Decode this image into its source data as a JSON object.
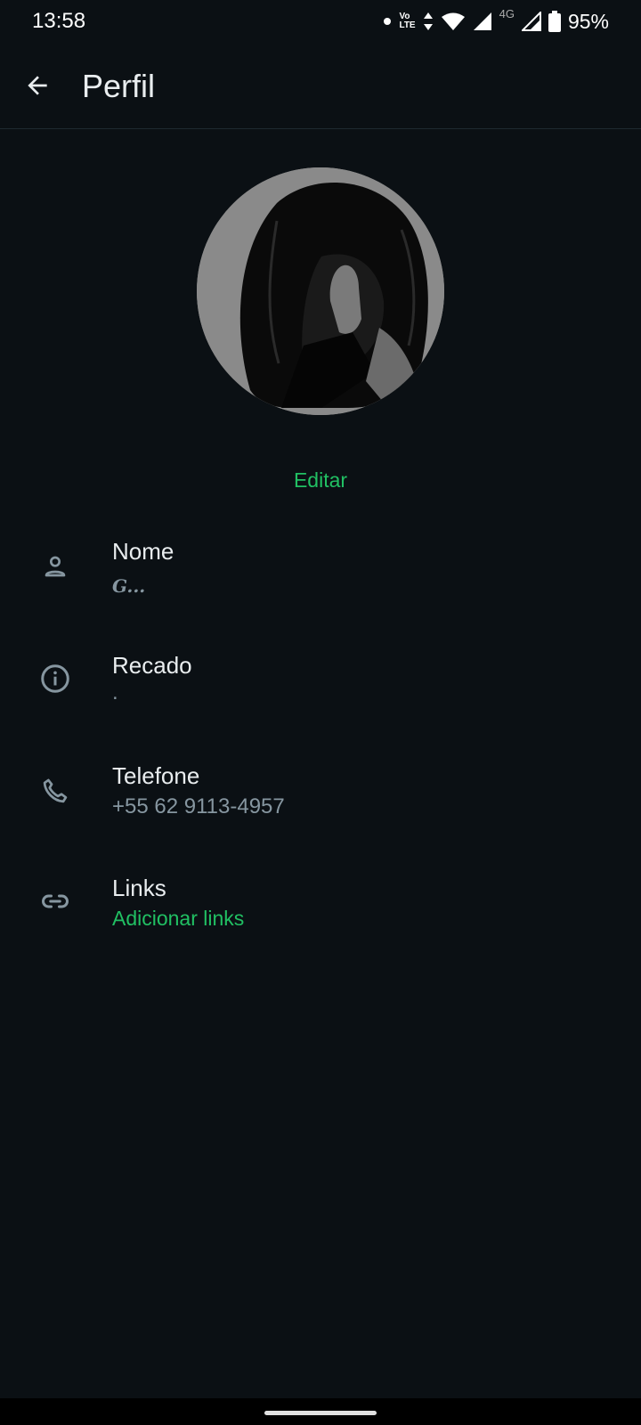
{
  "status_bar": {
    "time": "13:58",
    "volte_top": "Vo",
    "volte_bottom": "LTE",
    "network": "4G",
    "battery": "95%"
  },
  "app_bar": {
    "title": "Perfil"
  },
  "profile": {
    "edit_label": "Editar"
  },
  "fields": {
    "name": {
      "label": "Nome",
      "value": "G..."
    },
    "about": {
      "label": "Recado",
      "value": "."
    },
    "phone": {
      "label": "Telefone",
      "value": "+55 62 9113-4957"
    },
    "links": {
      "label": "Links",
      "value": "Adicionar links"
    }
  },
  "colors": {
    "background": "#0b1014",
    "accent": "#21c063",
    "primary_text": "#e9edef",
    "secondary_text": "#8696a0"
  }
}
